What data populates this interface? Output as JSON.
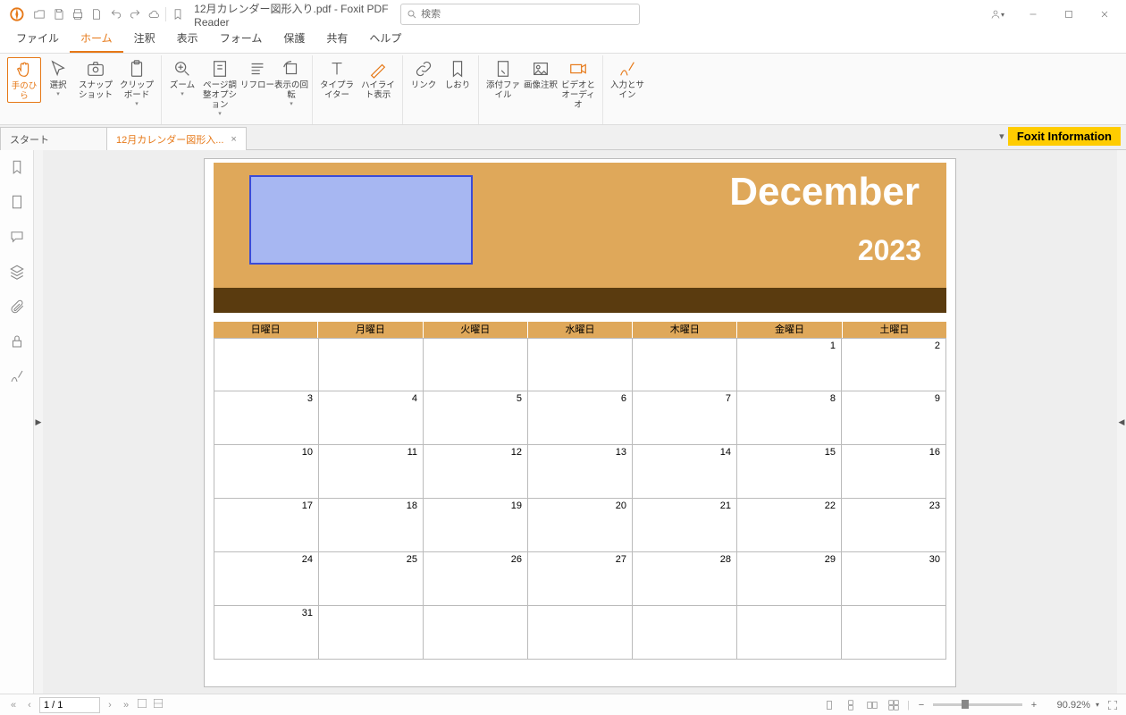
{
  "title": "12月カレンダー図形入り.pdf - Foxit PDF Reader",
  "search_placeholder": "検索",
  "menu": [
    "ファイル",
    "ホーム",
    "注釈",
    "表示",
    "フォーム",
    "保護",
    "共有",
    "ヘルプ"
  ],
  "menu_active": 1,
  "ribbon": {
    "hand": "手のひら",
    "select": "選択",
    "snapshot": "スナップショット",
    "clipboard": "クリップボード",
    "zoom": "ズーム",
    "pagefit": "ページ調整オプション",
    "reflow": "リフロー",
    "rotate": "表示の回転",
    "typewriter": "タイプライター",
    "highlight": "ハイライト表示",
    "link": "リンク",
    "bookmark": "しおり",
    "attach": "添付ファイル",
    "imgannot": "画像注釈",
    "video": "ビデオとオーディオ",
    "sign": "入力とサイン"
  },
  "tabs": {
    "start": "スタート",
    "doc": "12月カレンダー図形入..."
  },
  "notice": "Foxit Information",
  "calendar": {
    "month": "December",
    "year": "2023",
    "days": [
      "日曜日",
      "月曜日",
      "火曜日",
      "水曜日",
      "木曜日",
      "金曜日",
      "土曜日"
    ],
    "grid": [
      [
        "",
        "",
        "",
        "",
        "",
        "1",
        "2"
      ],
      [
        "3",
        "4",
        "5",
        "6",
        "7",
        "8",
        "9"
      ],
      [
        "10",
        "11",
        "12",
        "13",
        "14",
        "15",
        "16"
      ],
      [
        "17",
        "18",
        "19",
        "20",
        "21",
        "22",
        "23"
      ],
      [
        "24",
        "25",
        "26",
        "27",
        "28",
        "29",
        "30"
      ],
      [
        "31",
        "",
        "",
        "",
        "",
        "",
        ""
      ]
    ]
  },
  "status": {
    "page": "1 / 1",
    "zoom": "90.92%"
  }
}
